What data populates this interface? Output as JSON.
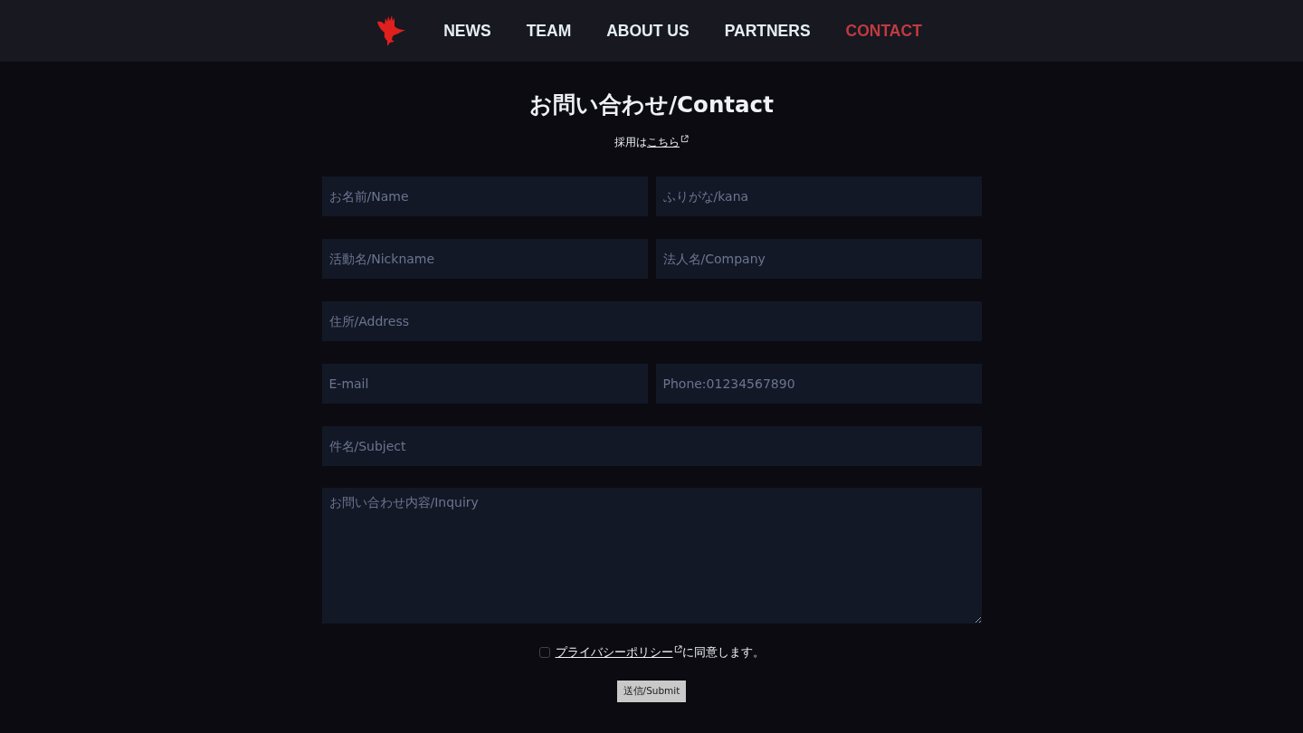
{
  "nav": {
    "items": [
      {
        "label": "NEWS",
        "selected": false
      },
      {
        "label": "TEAM",
        "selected": false
      },
      {
        "label": "ABOUT US",
        "selected": false
      },
      {
        "label": "PARTNERS",
        "selected": false
      },
      {
        "label": "CONTACT",
        "selected": true
      }
    ]
  },
  "heading": "お問い合わせ/Contact",
  "recruit_note": {
    "text": "採用は",
    "link": "こちら"
  },
  "form": {
    "fields": [
      {
        "kind": "half",
        "placeholder": "お名前/Name"
      },
      {
        "kind": "half",
        "placeholder": "ふりがな/kana"
      },
      {
        "kind": "half",
        "placeholder": "活動名/Nickname"
      },
      {
        "kind": "half",
        "placeholder": "法人名/Company"
      },
      {
        "kind": "full",
        "placeholder": "住所/Address"
      },
      {
        "kind": "half",
        "placeholder": "E-mail"
      },
      {
        "kind": "half",
        "placeholder": "Phone:01234567890"
      },
      {
        "kind": "full",
        "placeholder": "件名/Subject"
      },
      {
        "kind": "multiline",
        "placeholder": "お問い合わせ内容/Inquiry"
      }
    ],
    "consent": {
      "checked": false,
      "link": "プライバシーポリシー",
      "text": "に同意します。"
    },
    "submit": "送信/Submit"
  }
}
